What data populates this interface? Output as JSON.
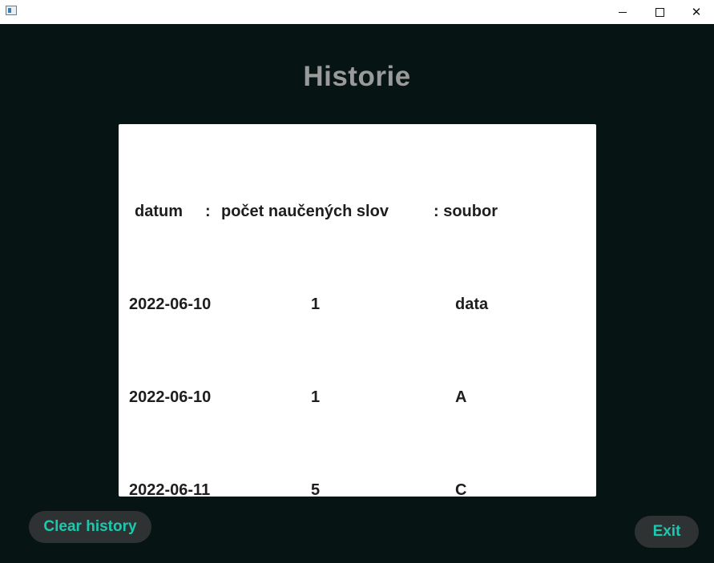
{
  "window": {
    "title": "",
    "controls": {
      "minimize_icon": "minimize-icon",
      "maximize_icon": "maximize-icon",
      "close_icon": "close-icon",
      "close_glyph": "✕"
    }
  },
  "page": {
    "title": "Historie"
  },
  "history": {
    "header": {
      "date": "datum",
      "sep1": ":",
      "count": "počet naučených slov",
      "sep2": ": soubor"
    },
    "rows": [
      {
        "date": "2022-06-10",
        "count": "1",
        "file": "data"
      },
      {
        "date": "2022-06-10",
        "count": "1",
        "file": "A"
      },
      {
        "date": "2022-06-11",
        "count": "5",
        "file": "C"
      }
    ]
  },
  "buttons": {
    "clear_history": "Clear history",
    "exit": "Exit"
  },
  "colors": {
    "background": "#061414",
    "title": "#9a9a9a",
    "panel": "#ffffff",
    "button_bg": "#2f3232",
    "button_text": "#1cc9b0"
  }
}
